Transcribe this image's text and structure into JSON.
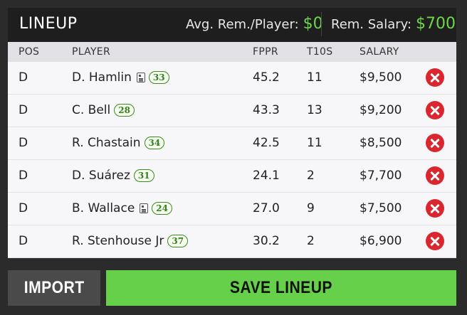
{
  "header": {
    "title": "LINEUP",
    "avg_label": "Avg. Rem./Player:",
    "avg_value": "$0",
    "rem_label": "Rem. Salary:",
    "rem_value": "$700"
  },
  "columns": {
    "pos": "POS",
    "player": "PLAYER",
    "fppr": "FPPR",
    "t10s": "T10S",
    "salary": "SALARY"
  },
  "rows": [
    {
      "pos": "D",
      "player": "D. Hamlin",
      "news": true,
      "number": "33",
      "fppr": "45.2",
      "t10s": "11",
      "salary": "$9,500"
    },
    {
      "pos": "D",
      "player": "C. Bell",
      "news": false,
      "number": "28",
      "fppr": "43.3",
      "t10s": "13",
      "salary": "$9,200"
    },
    {
      "pos": "D",
      "player": "R. Chastain",
      "news": false,
      "number": "34",
      "fppr": "42.5",
      "t10s": "11",
      "salary": "$8,500"
    },
    {
      "pos": "D",
      "player": "D. Suárez",
      "news": false,
      "number": "31",
      "fppr": "24.1",
      "t10s": "2",
      "salary": "$7,700"
    },
    {
      "pos": "D",
      "player": "B. Wallace",
      "news": true,
      "number": "24",
      "fppr": "27.0",
      "t10s": "9",
      "salary": "$7,500"
    },
    {
      "pos": "D",
      "player": "R. Stenhouse Jr",
      "news": false,
      "number": "37",
      "fppr": "30.2",
      "t10s": "2",
      "salary": "$6,900"
    }
  ],
  "buttons": {
    "import": "IMPORT",
    "save": "SAVE LINEUP"
  },
  "colors": {
    "accent_green": "#66d04a",
    "remove_red": "#d9262f",
    "badge_green": "#3a7d1e"
  },
  "icons": {
    "news": "news-icon",
    "remove": "remove-icon"
  }
}
